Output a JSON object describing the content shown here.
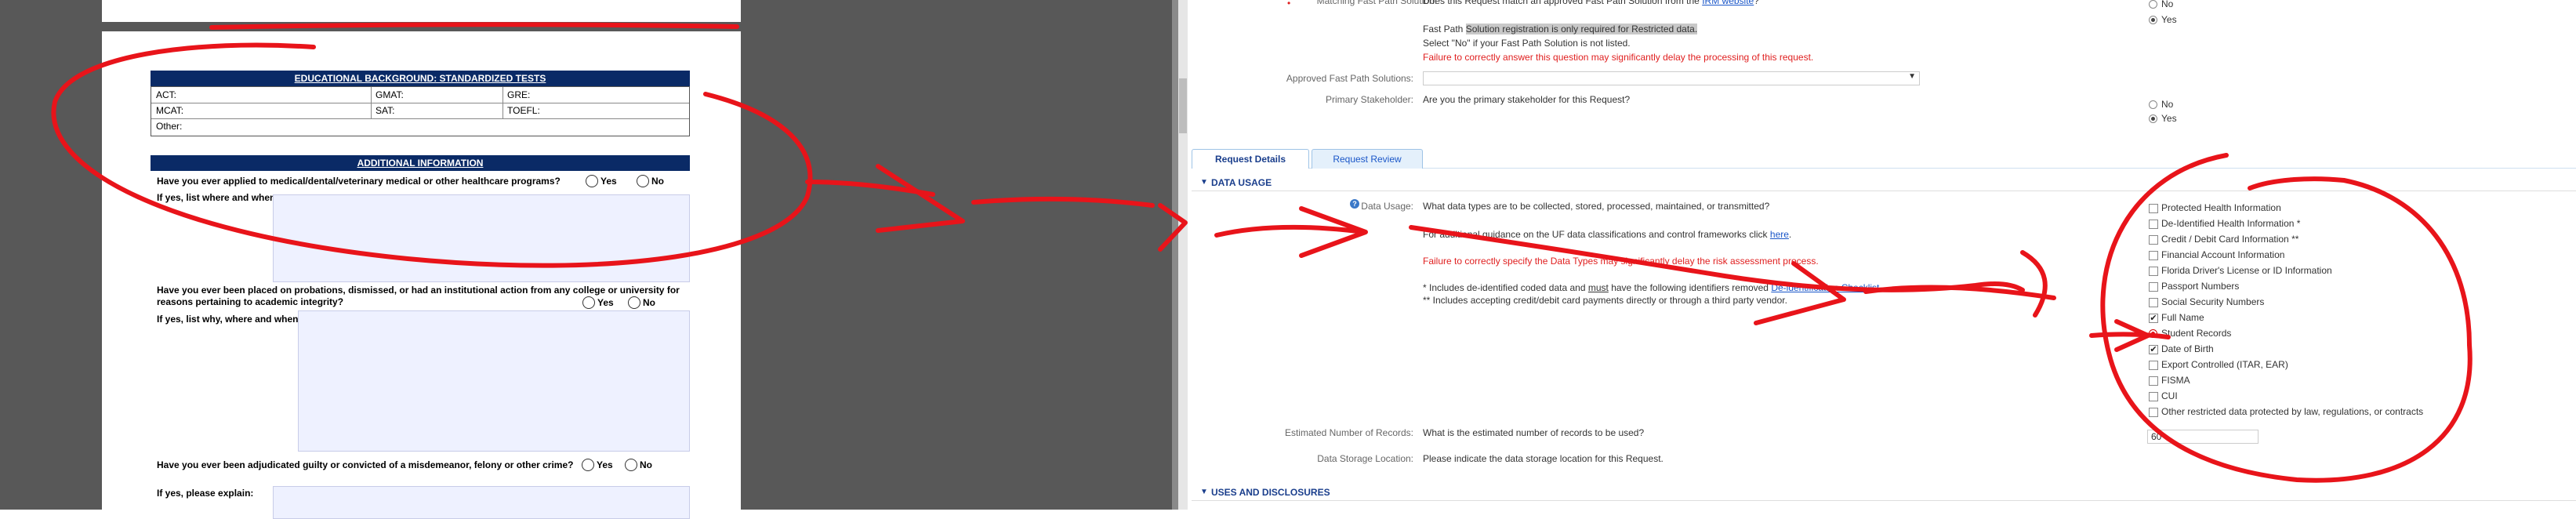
{
  "pdf": {
    "educational_header": "EDUCATIONAL BACKGROUND: STANDARDIZED TESTS",
    "tests": {
      "act": "ACT:",
      "gmat": "GMAT:",
      "gre": "GRE:",
      "mcat": "MCAT:",
      "sat": "SAT:",
      "toefl": "TOEFL:",
      "other": "Other:"
    },
    "additional_header": "ADDITIONAL INFORMATION",
    "q1": "Have you ever applied to medical/dental/veterinary medical or other healthcare programs?",
    "q1_yes": "Yes",
    "q1_no": "No",
    "q1_follow": "If yes, list where and when:",
    "q2_line1": "Have you ever been placed on probations, dismissed, or had an institutional action from any college or university for",
    "q2_line2": "reasons pertaining to academic integrity?",
    "q2_yes": "Yes",
    "q2_no": "No",
    "q2_follow": "If yes, list why, where and when:",
    "q3": "Have you ever been adjudicated guilty or convicted of a misdemeanor, felony or other crime?",
    "q3_yes": "Yes",
    "q3_no": "No",
    "q3_follow": "If yes, please explain:"
  },
  "form": {
    "fastpath_label": "Matching Fast Path Solution:",
    "fastpath_question": "Does this Request match an approved Fast Path Solution from the",
    "fastpath_link": "IRM website",
    "fastpath_q_end": "?",
    "fastpath_no": "No",
    "fastpath_yes": "Yes",
    "fastpath_note_prefix": "Fast Path",
    "fastpath_note_hl": "Solution registration is only required for Restricted data.",
    "fastpath_select_note": "Select \"No\" if your Fast Path Solution is not listed.",
    "fastpath_warning": "Failure to correctly answer this question may significantly delay the processing of this request.",
    "approved_label": "Approved Fast Path Solutions:",
    "approved_value": "",
    "stakeholder_label": "Primary Stakeholder:",
    "stakeholder_question": "Are you the primary stakeholder for this Request?",
    "stakeholder_no": "No",
    "stakeholder_yes": "Yes",
    "tabs": [
      "Request Details",
      "Request Review"
    ],
    "data_usage_title": "DATA USAGE",
    "data_usage_label": "Data Usage:",
    "data_usage_question": "What data types are to be collected, stored, processed, maintained, or transmitted?",
    "guidance_text": "For additional guidance on the UF data classifications and control frameworks click",
    "guidance_link": "here",
    "guidance_end": ".",
    "usage_warning": "Failure to correctly specify the Data Types may significantly delay the risk assessment process.",
    "note1_pre": "* Includes de-identified coded data and",
    "note1_must": "must",
    "note1_mid": "have the following identifiers removed",
    "note1_link": "De-identification Checklist",
    "note2": "** Includes accepting credit/debit card payments   directly or through a third party vendor.",
    "data_types": [
      {
        "label": "Protected Health Information",
        "state": "unchecked"
      },
      {
        "label": "De-Identified Health Information *",
        "state": "unchecked"
      },
      {
        "label": "Credit / Debit Card Information **",
        "state": "unchecked"
      },
      {
        "label": "Financial Account Information",
        "state": "unchecked"
      },
      {
        "label": "Florida Driver's License or ID Information",
        "state": "unchecked"
      },
      {
        "label": "Passport Numbers",
        "state": "unchecked"
      },
      {
        "label": "Social Security Numbers",
        "state": "unchecked"
      },
      {
        "label": "Full Name",
        "state": "checked"
      },
      {
        "label": "Student Records",
        "state": "radio"
      },
      {
        "label": "Date of Birth",
        "state": "checked"
      },
      {
        "label": "Export Controlled (ITAR, EAR)",
        "state": "unchecked"
      },
      {
        "label": "FISMA",
        "state": "unchecked"
      },
      {
        "label": "CUI",
        "state": "unchecked"
      },
      {
        "label": "Other restricted data protected by law, regulations, or contracts",
        "state": "unchecked"
      }
    ],
    "records_label": "Estimated Number of Records:",
    "records_question": "What is the estimated number of records to be used?",
    "records_value": "60",
    "storage_label": "Data Storage Location:",
    "storage_question": "Please indicate the data storage location for this Request.",
    "disclosures_title": "USES AND DISCLOSURES"
  },
  "colors": {
    "annotation": "#e8141a",
    "pdf_header": "#0a2a66",
    "answer_fill": "#eef1ff",
    "link": "#1a56c8",
    "warning": "#e02020"
  }
}
